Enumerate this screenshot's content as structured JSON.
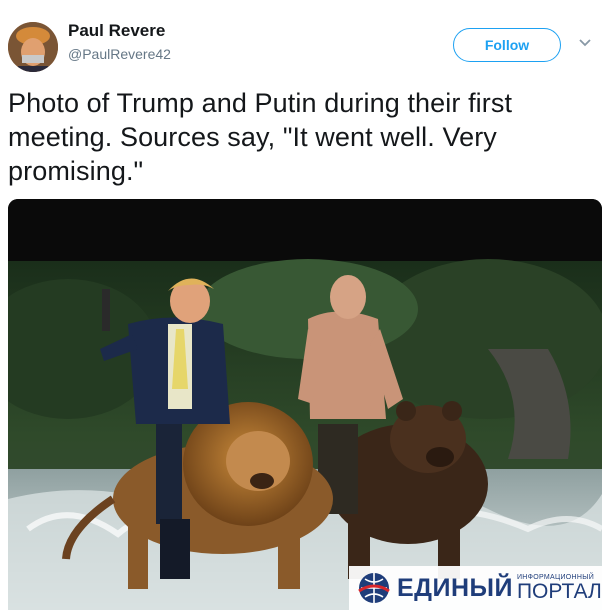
{
  "tweet": {
    "author_name": "Paul Revere",
    "author_handle": "@PaulRevere42",
    "follow_label": "Follow",
    "text": "Photo of Trump and Putin during their first meeting. Sources say, \"It went well. Very promising.\""
  },
  "icons": {
    "avatar": "avatar-photo",
    "menu": "chevron-down-icon"
  },
  "watermark": {
    "main": "ЕДИНЫЙ",
    "small": "ИНФОРМАЦИОННЫЙ",
    "portal": "ПОРТАЛ"
  },
  "colors": {
    "accent": "#1da1f2",
    "text": "#14171a",
    "muted": "#657786",
    "watermark": "#1f3d7a"
  }
}
